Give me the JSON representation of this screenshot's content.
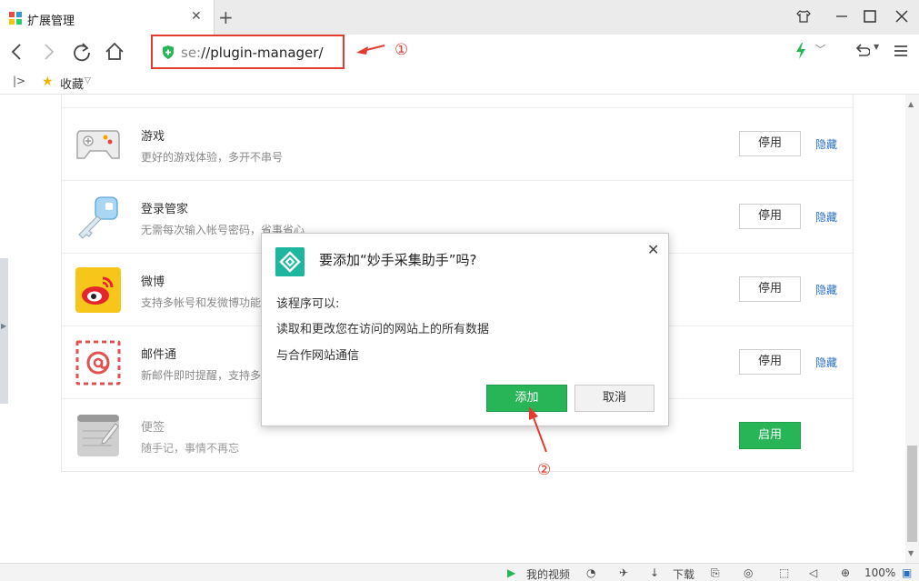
{
  "tab": {
    "title": "扩展管理"
  },
  "address": {
    "scheme": "se:",
    "path": "//plugin-manager/"
  },
  "bookmarks": {
    "label": "收藏"
  },
  "extensions": [
    {
      "name": "游戏",
      "desc": "更好的游戏体验，多开不串号",
      "button": "停用",
      "link": "隐藏",
      "enabled": true
    },
    {
      "name": "登录管家",
      "desc": "无需每次输入帐号密码，省事省心",
      "button": "停用",
      "link": "隐藏",
      "enabled": true
    },
    {
      "name": "微博",
      "desc": "支持多帐号和发微博功能",
      "button": "停用",
      "link": "隐藏",
      "enabled": true
    },
    {
      "name": "邮件通",
      "desc": "新邮件即时提醒，支持多",
      "button": "停用",
      "link": "隐藏",
      "enabled": true
    },
    {
      "name": "便签",
      "desc": "随手记，事情不再忘",
      "button": "启用",
      "enabled": false
    }
  ],
  "dialog": {
    "title": "要添加“妙手采集助手”吗?",
    "heading": "该程序可以:",
    "permissions": [
      "读取和更改您在访问的网站上的所有数据",
      "与合作网站通信"
    ],
    "add_label": "添加",
    "cancel_label": "取消"
  },
  "annotations": {
    "one": "①",
    "two": "②"
  },
  "statusbar": {
    "video": "我的视频",
    "download": "下载",
    "zoom": "100%"
  },
  "colors": {
    "accent_green": "#27b558",
    "annotation_red": "#e43b2f",
    "link_blue": "#2b6fc8"
  }
}
